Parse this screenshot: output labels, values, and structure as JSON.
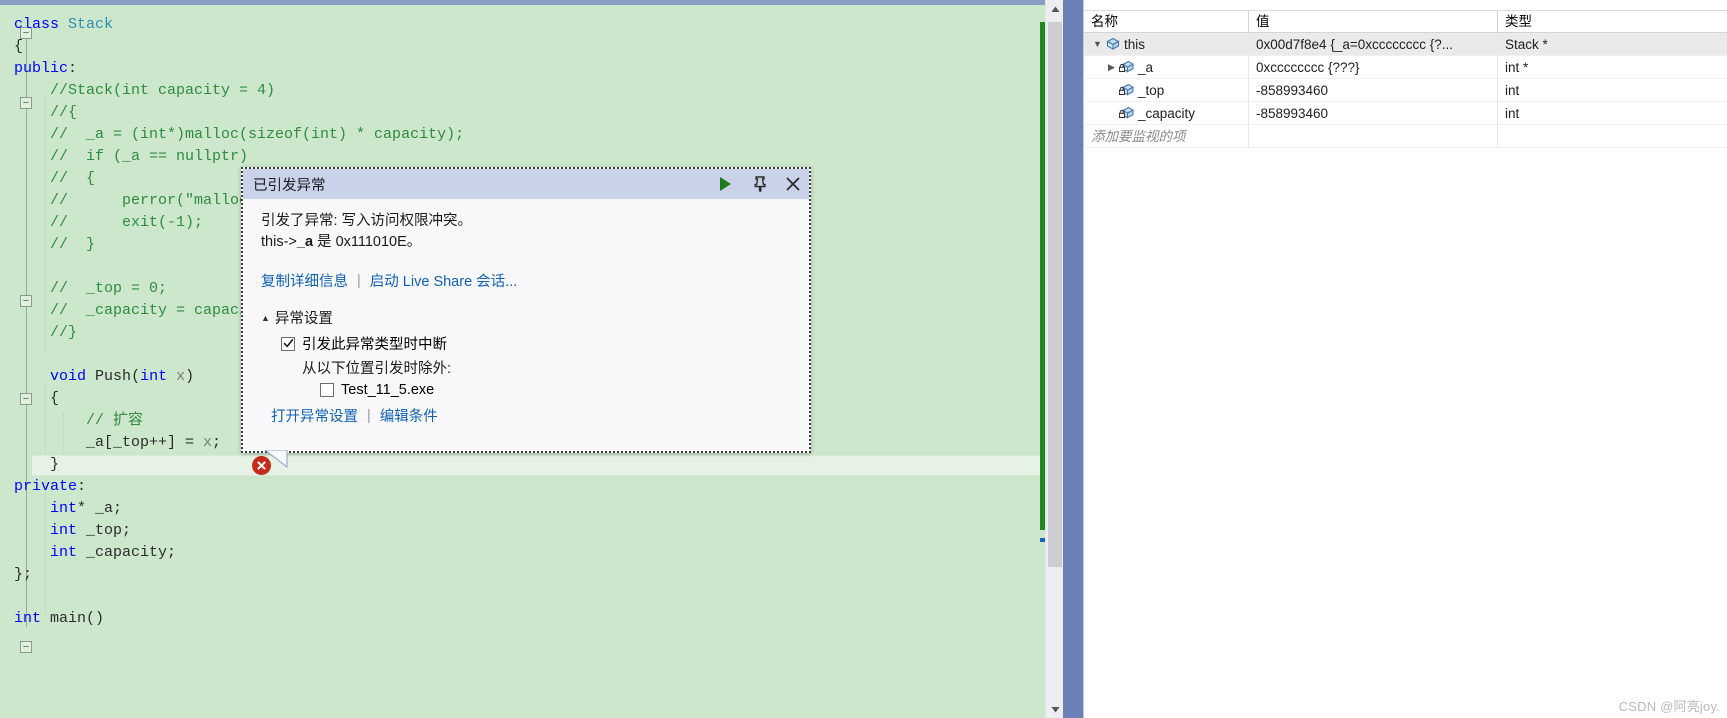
{
  "editor": {
    "code_lines": [
      {
        "indent": 0,
        "tokens": [
          {
            "t": "class ",
            "c": "kw"
          },
          {
            "t": "Stack",
            "c": "type"
          }
        ]
      },
      {
        "indent": 0,
        "tokens": [
          {
            "t": "{",
            "c": "pln"
          }
        ]
      },
      {
        "indent": 0,
        "tokens": [
          {
            "t": "public",
            "c": "kw"
          },
          {
            "t": ":",
            "c": "pln"
          }
        ]
      },
      {
        "indent": 0,
        "tokens": [
          {
            "t": "    //Stack(int capacity = 4)",
            "c": "cmt"
          }
        ]
      },
      {
        "indent": 0,
        "tokens": [
          {
            "t": "    //{",
            "c": "cmt"
          }
        ]
      },
      {
        "indent": 0,
        "tokens": [
          {
            "t": "    //  _a = (int*)malloc(sizeof(int) * capacity);",
            "c": "cmt"
          }
        ]
      },
      {
        "indent": 0,
        "tokens": [
          {
            "t": "    //  if (_a == nullptr)",
            "c": "cmt"
          }
        ]
      },
      {
        "indent": 0,
        "tokens": [
          {
            "t": "    //  {",
            "c": "cmt"
          }
        ]
      },
      {
        "indent": 0,
        "tokens": [
          {
            "t": "    //      perror(\"malloc fail\");",
            "c": "cmt"
          }
        ]
      },
      {
        "indent": 0,
        "tokens": [
          {
            "t": "    //      exit(-1);",
            "c": "cmt"
          }
        ]
      },
      {
        "indent": 0,
        "tokens": [
          {
            "t": "    //  }",
            "c": "cmt"
          }
        ]
      },
      {
        "indent": 0,
        "tokens": [
          {
            "t": "",
            "c": "pln"
          }
        ]
      },
      {
        "indent": 0,
        "tokens": [
          {
            "t": "    //  _top = 0;",
            "c": "cmt"
          }
        ]
      },
      {
        "indent": 0,
        "tokens": [
          {
            "t": "    //  _capacity = capacity;",
            "c": "cmt"
          }
        ]
      },
      {
        "indent": 0,
        "tokens": [
          {
            "t": "    //}",
            "c": "cmt"
          }
        ]
      },
      {
        "indent": 0,
        "tokens": [
          {
            "t": "",
            "c": "pln"
          }
        ]
      },
      {
        "indent": 0,
        "tokens": [
          {
            "t": "    ",
            "c": "pln"
          },
          {
            "t": "void",
            "c": "kw"
          },
          {
            "t": " ",
            "c": "pln"
          },
          {
            "t": "Push",
            "c": "id"
          },
          {
            "t": "(",
            "c": "pln"
          },
          {
            "t": "int",
            "c": "kw"
          },
          {
            "t": " ",
            "c": "pln"
          },
          {
            "t": "x",
            "c": "var"
          },
          {
            "t": ")",
            "c": "pln"
          }
        ]
      },
      {
        "indent": 0,
        "tokens": [
          {
            "t": "    {",
            "c": "pln"
          }
        ]
      },
      {
        "indent": 0,
        "tokens": [
          {
            "t": "        // 扩容",
            "c": "cmt"
          }
        ]
      },
      {
        "indent": 0,
        "tokens": [
          {
            "t": "        _a[_top++] = ",
            "c": "pln"
          },
          {
            "t": "x",
            "c": "var"
          },
          {
            "t": ";",
            "c": "pln"
          }
        ]
      },
      {
        "indent": 0,
        "tokens": [
          {
            "t": "    }",
            "c": "pln"
          }
        ]
      },
      {
        "indent": 0,
        "tokens": [
          {
            "t": "private",
            "c": "kw"
          },
          {
            "t": ":",
            "c": "pln"
          }
        ]
      },
      {
        "indent": 0,
        "tokens": [
          {
            "t": "    ",
            "c": "pln"
          },
          {
            "t": "int",
            "c": "kw"
          },
          {
            "t": "* _a;",
            "c": "pln"
          }
        ]
      },
      {
        "indent": 0,
        "tokens": [
          {
            "t": "    ",
            "c": "pln"
          },
          {
            "t": "int",
            "c": "kw"
          },
          {
            "t": " _top;",
            "c": "pln"
          }
        ]
      },
      {
        "indent": 0,
        "tokens": [
          {
            "t": "    ",
            "c": "pln"
          },
          {
            "t": "int",
            "c": "kw"
          },
          {
            "t": " _capacity;",
            "c": "pln"
          }
        ]
      },
      {
        "indent": 0,
        "tokens": [
          {
            "t": "};",
            "c": "pln"
          }
        ]
      },
      {
        "indent": 0,
        "tokens": [
          {
            "t": "",
            "c": "pln"
          }
        ]
      },
      {
        "indent": 0,
        "tokens": [
          {
            "t": "int",
            "c": "kw"
          },
          {
            "t": " ",
            "c": "pln"
          },
          {
            "t": "main",
            "c": "id"
          },
          {
            "t": "()",
            "c": "pln"
          }
        ]
      }
    ],
    "error_line_index": 19,
    "colors": {
      "background": "#cde7cd",
      "keyword": "#0000ff",
      "type": "#2b91af",
      "comment": "#2e8b3f",
      "error": "#c42b1c",
      "health_bar": "#1e8a1e"
    }
  },
  "exception_dialog": {
    "title": "已引发异常",
    "message_line1": "引发了异常: 写入访问权限冲突。",
    "message_line2_prefix": "this->",
    "message_line2_bold": "_a",
    "message_line2_suffix": " 是 0x111010E。",
    "link_copy_details": "复制详细信息",
    "link_live_share": "启动 Live Share 会话...",
    "separator": "|",
    "settings_group": "异常设置",
    "break_when_thrown": "引发此异常类型时中断",
    "break_when_thrown_checked": true,
    "except_when_thrown_from": "从以下位置引发时除外:",
    "exe_name": "Test_11_5.exe",
    "exe_checked": false,
    "link_open_exception_settings": "打开异常设置",
    "link_edit_conditions": "编辑条件",
    "icons": {
      "continue": "play-icon",
      "pin": "pin-icon",
      "close": "close-icon"
    },
    "colors": {
      "titlebar": "#c8d3ea",
      "link": "#1061b5",
      "play": "#1e7a1e"
    }
  },
  "watch_panel": {
    "columns": [
      "名称",
      "值",
      "类型"
    ],
    "rows": [
      {
        "name": "this",
        "value": "0x00d7f8e4 {_a=0xcccccccc {?...",
        "type": "Stack *",
        "depth": 0,
        "expander": "expanded",
        "icon": "object-icon",
        "selected": true
      },
      {
        "name": "_a",
        "value": "0xcccccccc {???}",
        "type": "int *",
        "depth": 1,
        "expander": "collapsed",
        "icon": "private-field-icon",
        "selected": false
      },
      {
        "name": "_top",
        "value": "-858993460",
        "type": "int",
        "depth": 1,
        "expander": "none",
        "icon": "private-field-icon",
        "selected": false
      },
      {
        "name": "_capacity",
        "value": "-858993460",
        "type": "int",
        "depth": 1,
        "expander": "none",
        "icon": "private-field-icon",
        "selected": false
      }
    ],
    "add_watch_placeholder": "添加要监视的项"
  },
  "watermark": "CSDN @阿亮joy."
}
